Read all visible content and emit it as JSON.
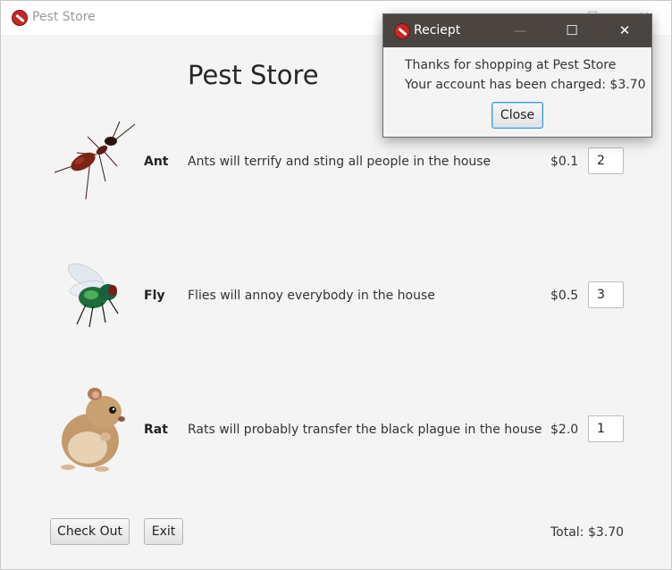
{
  "main_window": {
    "title": "Pest Store",
    "controls": {
      "minimize": "—",
      "maximize": "☐",
      "close": "✕"
    }
  },
  "store": {
    "heading": "Pest Store"
  },
  "pests": [
    {
      "name": "Ant",
      "description": "Ants will terrify and sting all people in the house",
      "price": "$0.1",
      "quantity": "2"
    },
    {
      "name": "Fly",
      "description": "Flies will annoy everybody in the house",
      "price": "$0.5",
      "quantity": "3"
    },
    {
      "name": "Rat",
      "description": "Rats will probably transfer the black plague in the house",
      "price": "$2.0",
      "quantity": "1"
    }
  ],
  "footer": {
    "checkout_label": "Check Out",
    "exit_label": "Exit",
    "total_label": "Total:",
    "total_value": "$3.70"
  },
  "receipt_dialog": {
    "title": "Reciept",
    "controls": {
      "minimize": "—",
      "maximize": "☐",
      "close": "✕"
    },
    "line1": "Thanks for shopping at Pest Store",
    "line2": "Your account has been charged: $3.70",
    "close_label": "Close"
  }
}
